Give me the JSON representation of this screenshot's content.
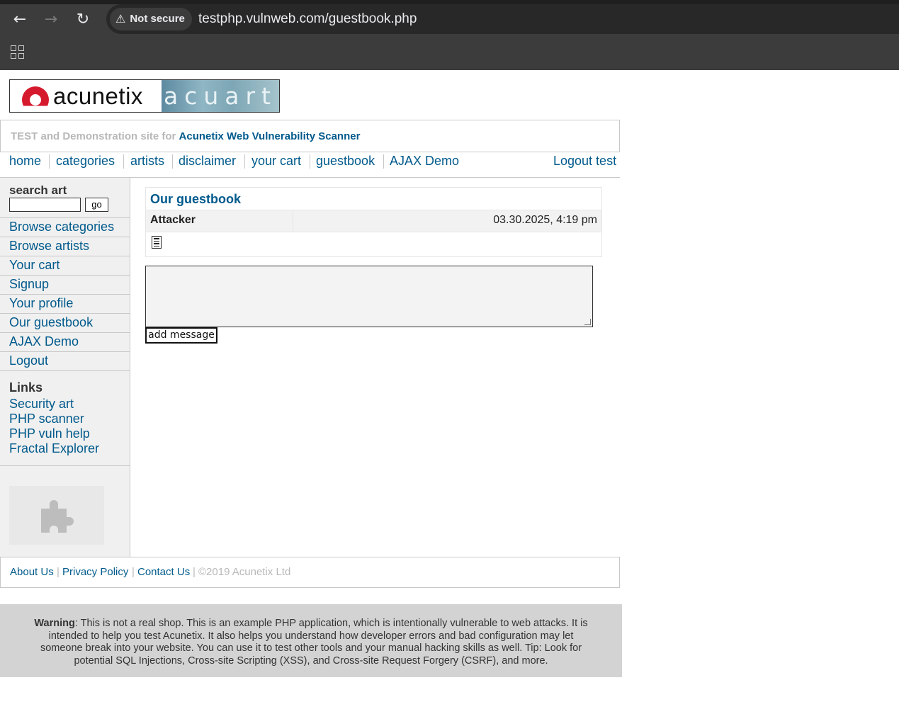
{
  "browser": {
    "security_label": "Not secure",
    "url": "testphp.vulnweb.com/guestbook.php"
  },
  "site": {
    "logo_left_text": "acunetix",
    "logo_right_text": "acuart",
    "tagline_prefix": "TEST and Demonstration site for",
    "tagline_brand": "Acunetix Web Vulnerability Scanner"
  },
  "topnav": {
    "items": [
      "home",
      "categories",
      "artists",
      "disclaimer",
      "your cart",
      "guestbook",
      "AJAX Demo"
    ],
    "logout": "Logout test"
  },
  "sidebar": {
    "search_title": "search art",
    "search_button": "go",
    "menu": [
      "Browse categories",
      "Browse artists",
      "Your cart",
      "Signup",
      "Your profile",
      "Our guestbook",
      "AJAX Demo",
      "Logout"
    ],
    "links_title": "Links",
    "links": [
      "Security art",
      "PHP scanner",
      "PHP vuln help",
      "Fractal Explorer"
    ]
  },
  "guestbook": {
    "title": "Our guestbook",
    "entries": [
      {
        "author": "Attacker",
        "date": "03.30.2025, 4:19 pm"
      }
    ],
    "textarea_value": "",
    "submit_label": "add message"
  },
  "footer": {
    "links": [
      "About Us",
      "Privacy Policy",
      "Contact Us"
    ],
    "copyright": "©2019 Acunetix Ltd",
    "separator": "|"
  },
  "warning": {
    "label": "Warning",
    "text": ": This is not a real shop. This is an example PHP application, which is intentionally vulnerable to web attacks. It is intended to help you test Acunetix. It also helps you understand how developer errors and bad configuration may let someone break into your website. You can use it to test other tools and your manual hacking skills as well. Tip: Look for potential SQL Injections, Cross-site Scripting (XSS), and Cross-site Request Forgery (CSRF), and more."
  },
  "icons": {
    "back": "back-arrow-icon",
    "forward": "forward-arrow-icon",
    "reload": "reload-icon",
    "warning": "warning-triangle-icon",
    "apps": "apps-grid-icon",
    "entry": "document-icon",
    "plugin": "puzzle-piece-icon"
  },
  "colors": {
    "link": "#005a8c",
    "muted": "#b8b8b8",
    "sidebar_bg": "#f0f0f0",
    "warning_bg": "#d3d3d3"
  }
}
